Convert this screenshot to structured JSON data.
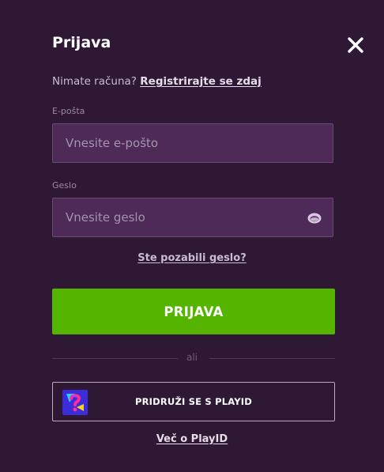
{
  "header": {
    "title": "Prijava",
    "close_icon": "close-icon"
  },
  "signup": {
    "prompt": "Nimate računa?",
    "link": "Registrirajte se zdaj"
  },
  "email": {
    "label": "E-pošta",
    "value": "",
    "placeholder": "Vnesite e-pošto"
  },
  "password": {
    "label": "Geslo",
    "value": "",
    "placeholder": "Vnesite geslo",
    "toggle_icon": "eye-icon"
  },
  "forgot_link": "Ste pozabili geslo?",
  "login_button": "PRIJAVA",
  "divider_text": "ali",
  "playid": {
    "button_label": "PRIDRUŽI SE S PLAYID",
    "logo_icon": "playid-logo-icon",
    "more_link": "Več o PlayID"
  },
  "colors": {
    "background": "#2e1834",
    "input_background": "#4e2a58",
    "primary_button": "#54b400",
    "text_primary": "#ffffff",
    "text_muted": "#c7bccd"
  }
}
